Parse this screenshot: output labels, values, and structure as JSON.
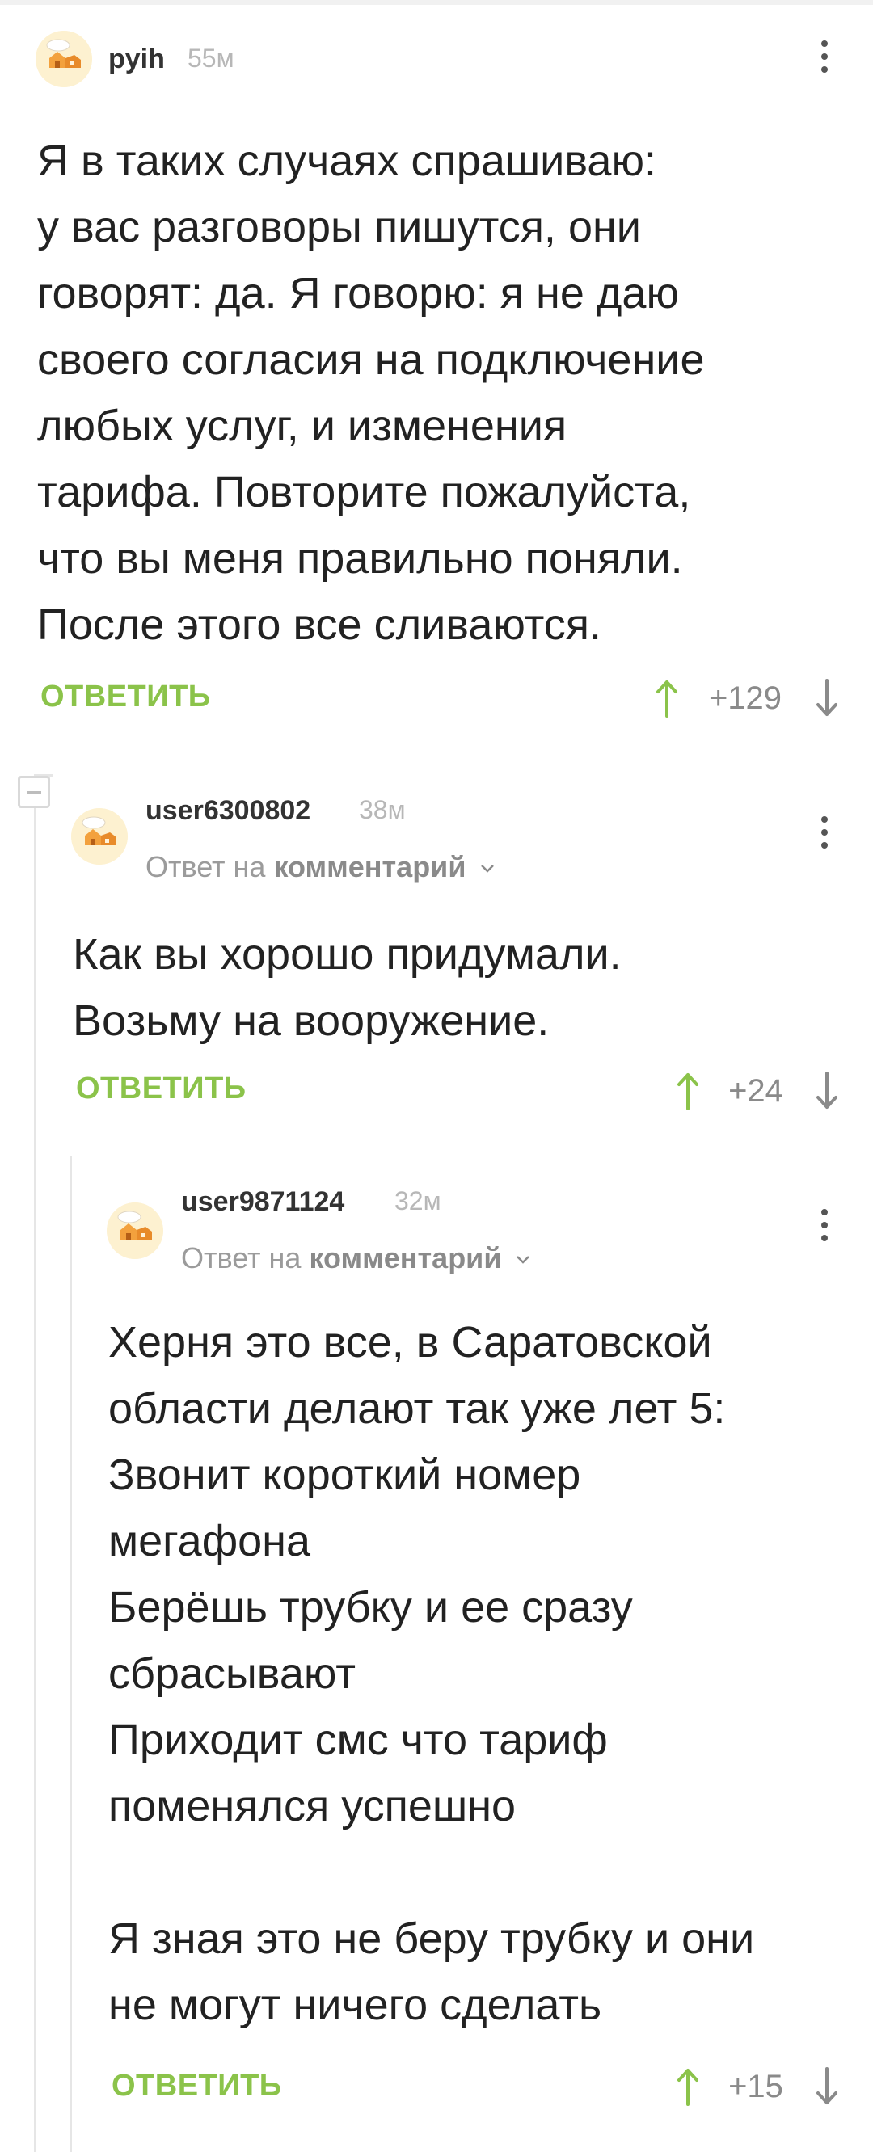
{
  "comments": [
    {
      "username": "pyih",
      "time": "55м",
      "text": "Я в таких случаях спрашиваю:\nу вас разговоры пишутся, они\nговорят: да. Я говорю: я не даю\nсвоего согласия на подключение\nлюбых услуг, и изменения\nтарифа. Повторите пожалуйста,\nчто вы меня правильно поняли.\nПосле этого все сливаются.",
      "reply_label": "ОТВЕТИТЬ",
      "rating": "+129"
    },
    {
      "username": "user6300802",
      "time": "38м",
      "reply_to_prefix": "Ответ на",
      "reply_to_link": "комментарий",
      "text": "Как вы хорошо придумали.\nВозьму на вооружение.",
      "reply_label": "ОТВЕТИТЬ",
      "rating": "+24"
    },
    {
      "username": "user9871124",
      "time": "32м",
      "reply_to_prefix": "Ответ на",
      "reply_to_link": "комментарий",
      "text": "Херня это все, в Саратовской\nобласти делают так уже лет 5:\nЗвонит короткий номер\nмегафона\nБерёшь трубку и ее сразу\nсбрасывают\nПриходит смс что тариф\nпоменялся успешно\n\nЯ зная это не беру трубку и они\nне могут ничего сделать",
      "reply_label": "ОТВЕТИТЬ",
      "rating": "+15"
    }
  ],
  "colors": {
    "accent": "#8bc34a",
    "muted": "#9b9b9b",
    "text": "#222222",
    "thread_line": "#e6e6e6"
  },
  "icons": {
    "avatar": "default-avatar-icon",
    "menu": "more-vertical-icon",
    "upvote": "arrow-up-icon",
    "downvote": "arrow-down-icon",
    "collapse": "collapse-minus-icon"
  }
}
